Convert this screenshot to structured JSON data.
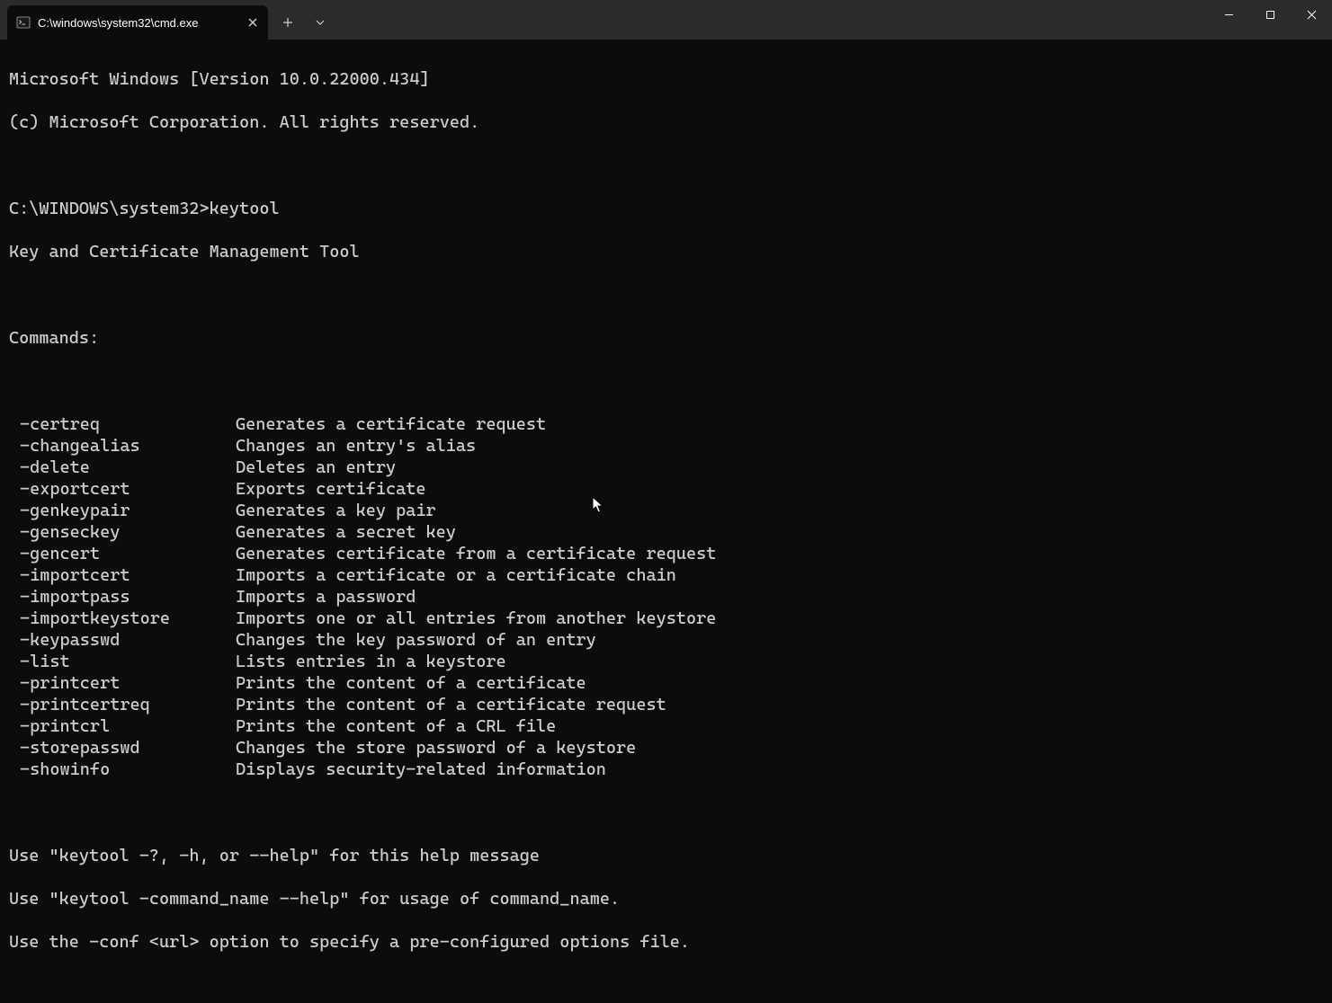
{
  "titlebar": {
    "tab_title": "C:\\windows\\system32\\cmd.exe"
  },
  "terminal": {
    "banner1": "Microsoft Windows [Version 10.0.22000.434]",
    "banner2": "(c) Microsoft Corporation. All rights reserved.",
    "prompt": "C:\\WINDOWS\\system32>keytool",
    "tool_title": "Key and Certificate Management Tool",
    "commands_header": "Commands:",
    "commands": [
      {
        "flag": "-certreq",
        "desc": "Generates a certificate request"
      },
      {
        "flag": "-changealias",
        "desc": "Changes an entry's alias"
      },
      {
        "flag": "-delete",
        "desc": "Deletes an entry"
      },
      {
        "flag": "-exportcert",
        "desc": "Exports certificate"
      },
      {
        "flag": "-genkeypair",
        "desc": "Generates a key pair"
      },
      {
        "flag": "-genseckey",
        "desc": "Generates a secret key"
      },
      {
        "flag": "-gencert",
        "desc": "Generates certificate from a certificate request"
      },
      {
        "flag": "-importcert",
        "desc": "Imports a certificate or a certificate chain"
      },
      {
        "flag": "-importpass",
        "desc": "Imports a password"
      },
      {
        "flag": "-importkeystore",
        "desc": "Imports one or all entries from another keystore"
      },
      {
        "flag": "-keypasswd",
        "desc": "Changes the key password of an entry"
      },
      {
        "flag": "-list",
        "desc": "Lists entries in a keystore"
      },
      {
        "flag": "-printcert",
        "desc": "Prints the content of a certificate"
      },
      {
        "flag": "-printcertreq",
        "desc": "Prints the content of a certificate request"
      },
      {
        "flag": "-printcrl",
        "desc": "Prints the content of a CRL file"
      },
      {
        "flag": "-storepasswd",
        "desc": "Changes the store password of a keystore"
      },
      {
        "flag": "-showinfo",
        "desc": "Displays security-related information"
      }
    ],
    "footer1": "Use \"keytool -?, -h, or --help\" for this help message",
    "footer2": "Use \"keytool -command_name --help\" for usage of command_name.",
    "footer3": "Use the -conf <url> option to specify a pre-configured options file."
  }
}
